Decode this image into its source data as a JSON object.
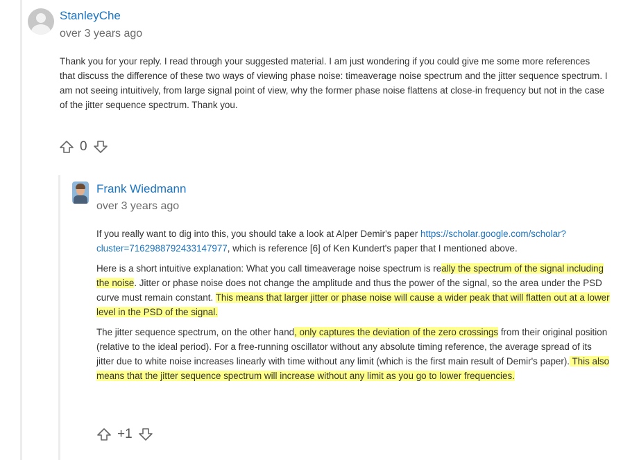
{
  "comment1": {
    "author": "StanleyChe",
    "timestamp": "over 3 years ago",
    "body": "Thank you for your reply. I read through your suggested material. I am just wondering if you could give me some more references that discuss the difference of these two ways of viewing phase noise: timeaverage noise spectrum and the jitter sequence spectrum. I am not seeing intuitively, from large signal point of view, why the former phase noise flattens at close-in frequency but not in the case of the jitter sequence spectrum. Thank you.",
    "vote_count": "0"
  },
  "comment2": {
    "author": "Frank Wiedmann",
    "timestamp": "over 3 years ago",
    "p1_before": "If you really want to dig into this, you should take a look at Alper Demir's paper ",
    "p1_link": "https://scholar.google.com/scholar?cluster=7162988792433147977",
    "p1_after": ", which is reference [6] of Ken Kundert's paper that I mentioned above.",
    "p2_a": "Here is a short intuitive explanation: What you call timeaverage noise spectrum is re",
    "p2_b": "ally the spectrum of the signal including the noise",
    "p2_c": ". Jitter or phase noise does not change the amplitude and thus the power of the signal, so the area under the PSD curve must remain constant. ",
    "p2_d": "This means that larger jitter or phase noise will cause a wider peak that will flatten out at a lower level in the PSD of the signal.",
    "p3_a": "The jitter sequence spectrum, on the other hand",
    "p3_b": ", only captures the deviation of the zero crossings",
    "p3_c": " from their original position (relative to the ideal period). For a free-running oscillator without any absolute timing reference, the average spread of its jitter due to white noise increases linearly with time without any limit (which is the first main result of Demir's paper).",
    "p3_d": " This also means that the jitter sequence spectrum will increase without any limit as you go to lower frequencies.",
    "vote_count": "+1"
  },
  "icons": {
    "avatar_default": "default-user-avatar",
    "avatar_photo": "user-photo-avatar",
    "upvote": "arrow-up-outline-icon",
    "downvote": "arrow-down-outline-icon"
  },
  "colors": {
    "link": "#1a74c2",
    "highlight": "#ffff8c",
    "thread_line": "#ececec"
  }
}
